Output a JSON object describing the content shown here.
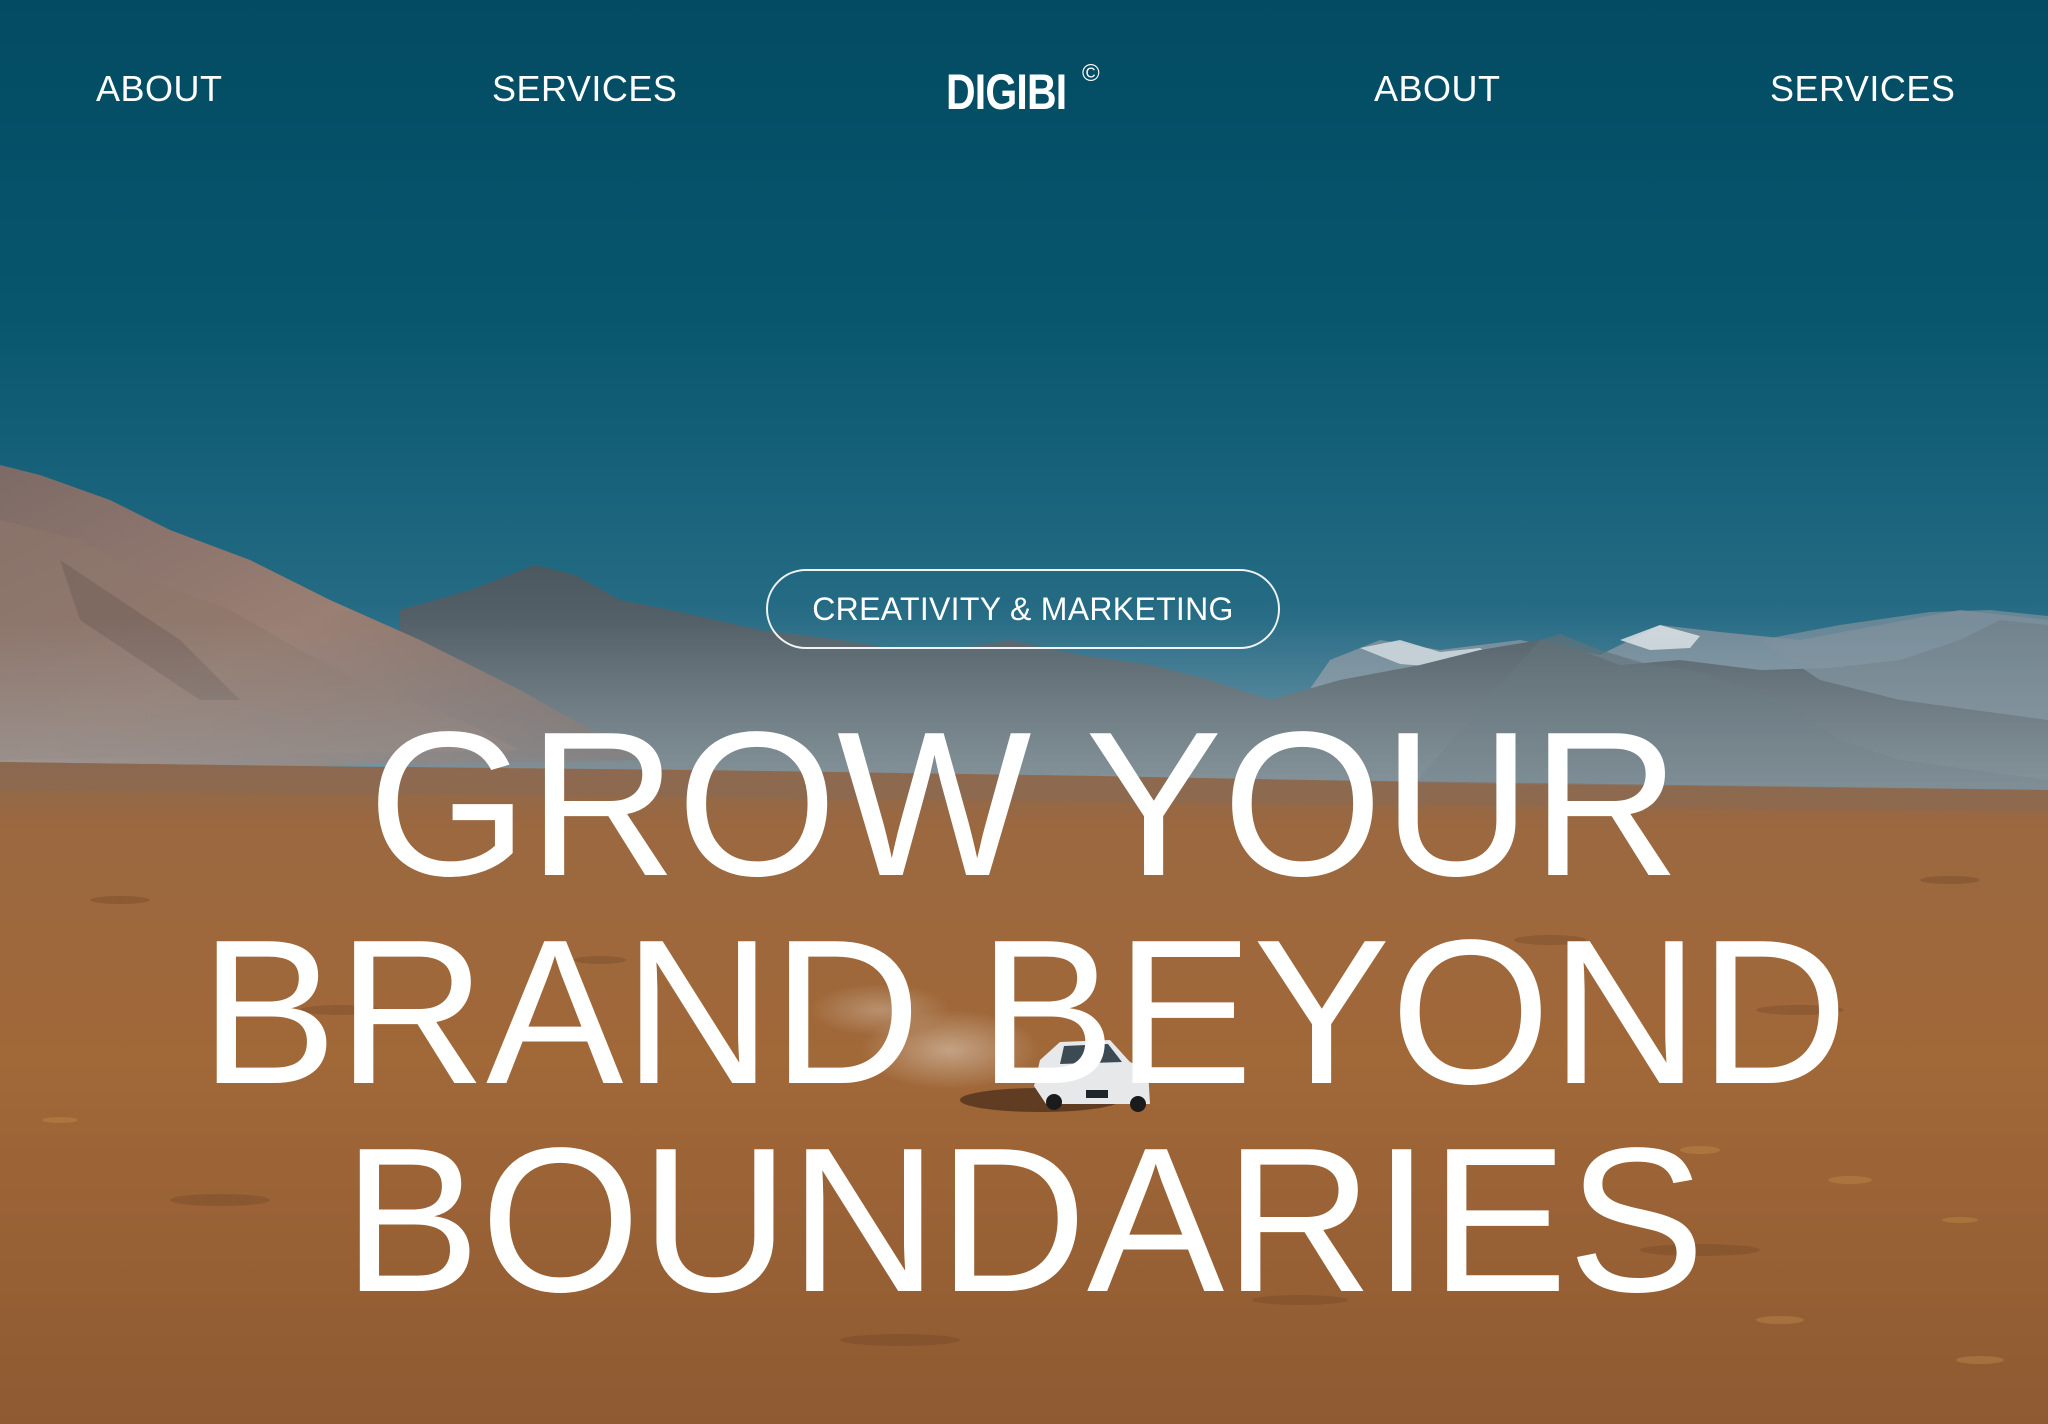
{
  "nav": {
    "left_items": [
      {
        "label": "ABOUT"
      },
      {
        "label": "SERVICES"
      }
    ],
    "right_items": [
      {
        "label": "ABOUT"
      },
      {
        "label": "SERVICES"
      }
    ]
  },
  "logo": {
    "text": "DIGIBI",
    "mark": "©"
  },
  "hero": {
    "tag": "CREATIVITY & MARKETING",
    "headline_lines": [
      "GROW YOUR",
      "BRAND BEYOND",
      "BOUNDARIES"
    ]
  },
  "colors": {
    "sky_top": "#034f66",
    "sky_horizon": "#5e8aa0",
    "ground": "#a36a3e",
    "text": "#ffffff"
  }
}
